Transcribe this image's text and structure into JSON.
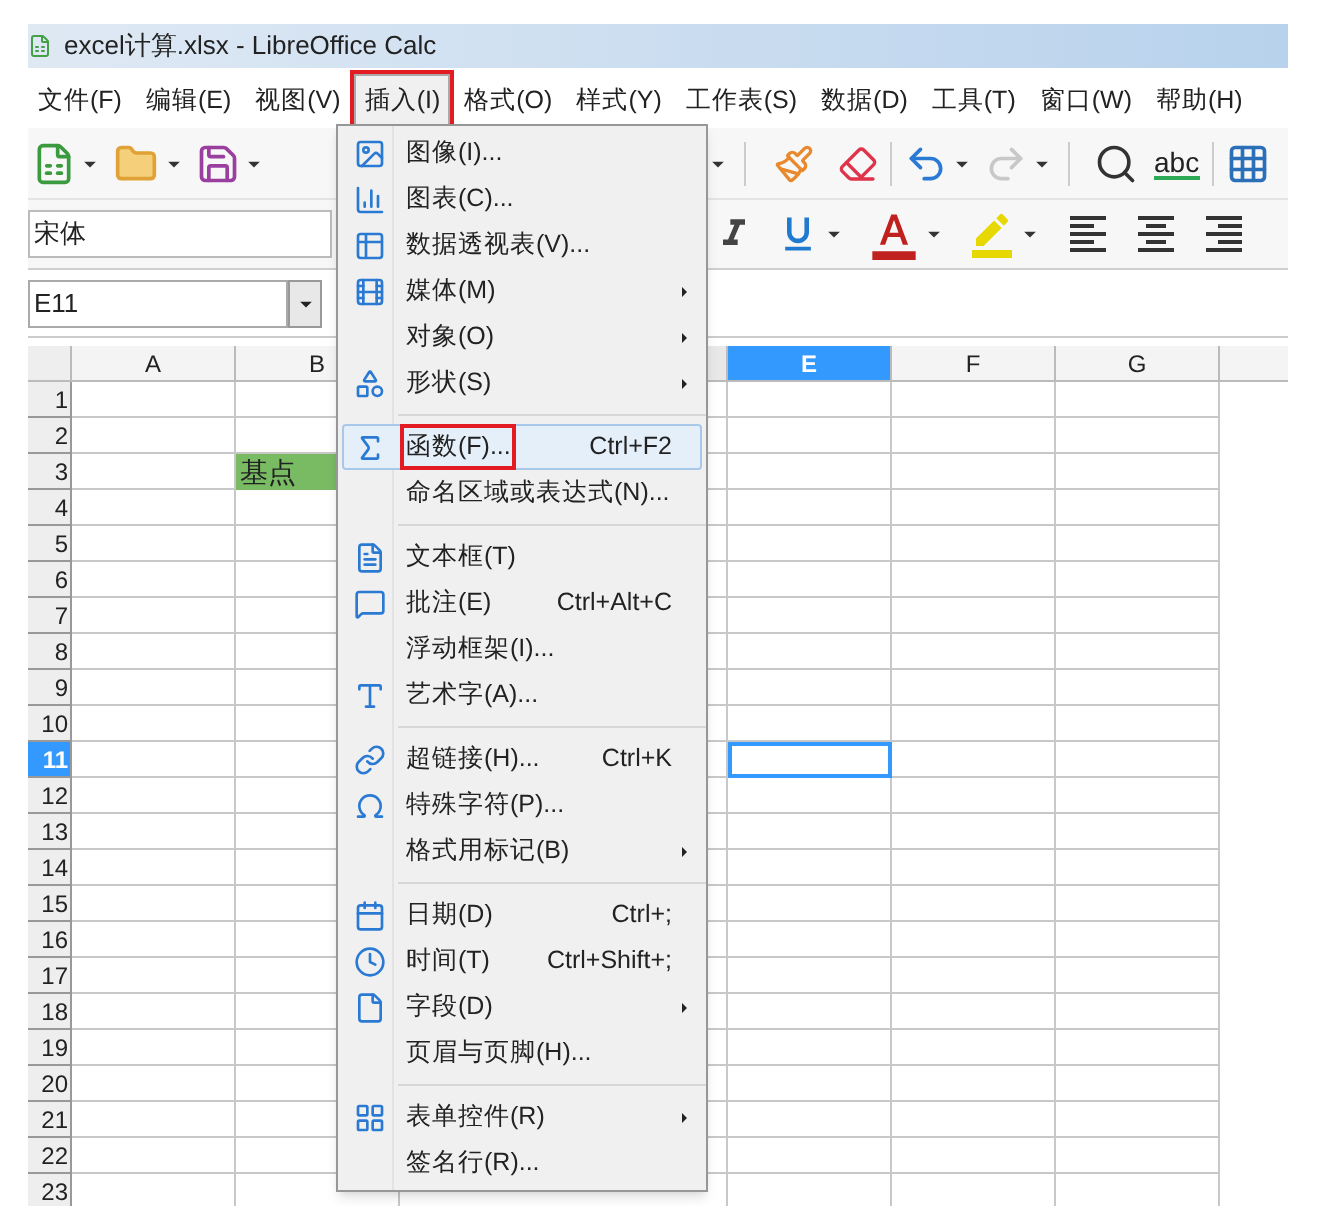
{
  "window": {
    "title": "excel计算.xlsx - LibreOffice Calc"
  },
  "menubar": [
    {
      "label": "文件(F)",
      "selected": false,
      "marked": false
    },
    {
      "label": "编辑(E)",
      "selected": false,
      "marked": false
    },
    {
      "label": "视图(V)",
      "selected": false,
      "marked": false
    },
    {
      "label": "插入(I)",
      "selected": true,
      "marked": true
    },
    {
      "label": "格式(O)",
      "selected": false,
      "marked": false
    },
    {
      "label": "样式(Y)",
      "selected": false,
      "marked": false
    },
    {
      "label": "工作表(S)",
      "selected": false,
      "marked": false
    },
    {
      "label": "数据(D)",
      "selected": false,
      "marked": false
    },
    {
      "label": "工具(T)",
      "selected": false,
      "marked": false
    },
    {
      "label": "窗口(W)",
      "selected": false,
      "marked": false
    },
    {
      "label": "帮助(H)",
      "selected": false,
      "marked": false
    }
  ],
  "toolbar": {
    "spellcheck_label": "abc",
    "redo_disabled": true
  },
  "format_bar": {
    "font_name": "宋体"
  },
  "name_box": {
    "value": "E11"
  },
  "insert_menu": [
    [
      {
        "label": "图像(I)...",
        "submenu": false,
        "selected": false,
        "marked": false
      },
      {
        "label": "图表(C)...",
        "submenu": false,
        "selected": false,
        "marked": false
      },
      {
        "label": "数据透视表(V)...",
        "submenu": false,
        "selected": false,
        "marked": false
      },
      {
        "label": "媒体(M)",
        "submenu": true,
        "selected": false,
        "marked": false
      },
      {
        "label": "对象(O)",
        "submenu": true,
        "selected": false,
        "marked": false
      },
      {
        "label": "形状(S)",
        "submenu": true,
        "selected": false,
        "marked": false
      }
    ],
    [
      {
        "label": "函数(F)...",
        "shortcut": "Ctrl+F2",
        "submenu": false,
        "selected": true,
        "marked": true
      },
      {
        "label": "命名区域或表达式(N)...",
        "submenu": false,
        "selected": false,
        "marked": false
      }
    ],
    [
      {
        "label": "文本框(T)",
        "submenu": false,
        "selected": false,
        "marked": false
      },
      {
        "label": "批注(E)",
        "shortcut": "Ctrl+Alt+C",
        "submenu": false,
        "selected": false,
        "marked": false
      },
      {
        "label": "浮动框架(I)...",
        "submenu": false,
        "selected": false,
        "marked": false
      },
      {
        "label": "艺术字(A)...",
        "submenu": false,
        "selected": false,
        "marked": false
      }
    ],
    [
      {
        "label": "超链接(H)...",
        "shortcut": "Ctrl+K",
        "submenu": false,
        "selected": false,
        "marked": false
      },
      {
        "label": "特殊字符(P)...",
        "submenu": false,
        "selected": false,
        "marked": false
      },
      {
        "label": "格式用标记(B)",
        "submenu": true,
        "selected": false,
        "marked": false
      }
    ],
    [
      {
        "label": "日期(D)",
        "shortcut": "Ctrl+;",
        "submenu": false,
        "selected": false,
        "marked": false
      },
      {
        "label": "时间(T)",
        "shortcut": "Ctrl+Shift+;",
        "submenu": false,
        "selected": false,
        "marked": false
      },
      {
        "label": "字段(D)",
        "submenu": true,
        "selected": false,
        "marked": false
      },
      {
        "label": "页眉与页脚(H)...",
        "submenu": false,
        "selected": false,
        "marked": false
      }
    ],
    [
      {
        "label": "表单控件(R)",
        "submenu": true,
        "selected": false,
        "marked": false
      },
      {
        "label": "签名行(R)...",
        "submenu": false,
        "selected": false,
        "marked": false
      }
    ]
  ],
  "sheet": {
    "columns": [
      {
        "label": "A",
        "selected": false
      },
      {
        "label": "B",
        "selected": false
      },
      {
        "kind": "hidden"
      },
      {
        "label": "E",
        "selected": true
      },
      {
        "label": "F",
        "selected": false
      },
      {
        "label": "G",
        "selected": false
      }
    ],
    "rows": [
      {
        "label": "1",
        "selected": false
      },
      {
        "label": "2",
        "selected": false
      },
      {
        "label": "3",
        "selected": false,
        "cells": [
          {
            "kind": "empty"
          },
          {
            "kind": "text",
            "text": "基点",
            "color": "#79bb63"
          }
        ]
      },
      {
        "label": "4",
        "selected": false
      },
      {
        "label": "5",
        "selected": false
      },
      {
        "label": "6",
        "selected": false
      },
      {
        "label": "7",
        "selected": false
      },
      {
        "label": "8",
        "selected": false
      },
      {
        "label": "9",
        "selected": false
      },
      {
        "label": "10",
        "selected": false
      },
      {
        "label": "11",
        "selected": true
      },
      {
        "label": "12",
        "selected": false
      },
      {
        "label": "13",
        "selected": false
      },
      {
        "label": "14",
        "selected": false
      },
      {
        "label": "15",
        "selected": false
      },
      {
        "label": "16",
        "selected": false
      },
      {
        "label": "17",
        "selected": false
      },
      {
        "label": "18",
        "selected": false
      },
      {
        "label": "19",
        "selected": false
      },
      {
        "label": "20",
        "selected": false
      },
      {
        "label": "21",
        "selected": false
      },
      {
        "label": "22",
        "selected": false
      },
      {
        "label": "23",
        "selected": false
      }
    ]
  }
}
